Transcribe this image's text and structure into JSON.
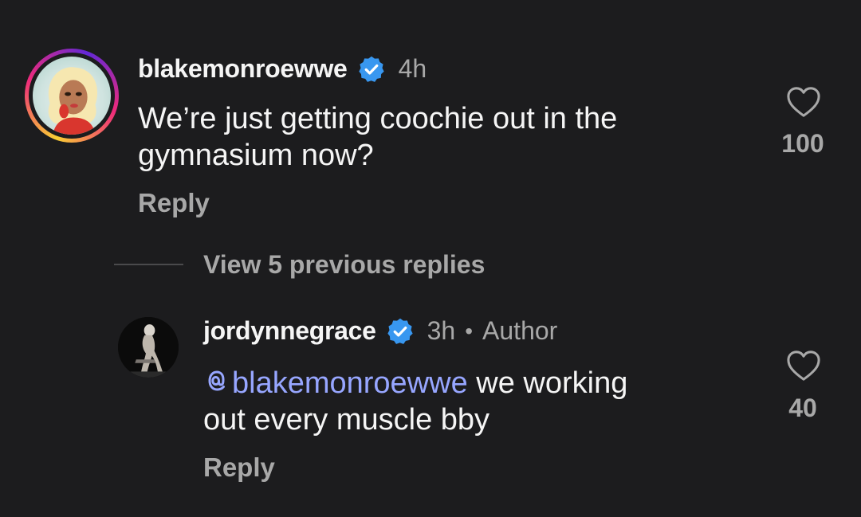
{
  "comments": [
    {
      "username": "blakemonroewwe",
      "verified": true,
      "time": "4h",
      "text": "We’re just getting coochie out in the gymnasium now?",
      "reply_label": "Reply",
      "likes": "100",
      "avatar_icon": "cartoon-avatar-icon"
    }
  ],
  "view_replies_label": "View 5 previous replies",
  "replies": [
    {
      "username": "jordynnegrace",
      "verified": true,
      "time": "3h",
      "separator": "•",
      "role": "Author",
      "mention": "blakemonroewwe",
      "text_line1": " we working",
      "text_line2": "out every muscle bby",
      "reply_label": "Reply",
      "likes": "40",
      "avatar_icon": "photo-avatar-icon"
    }
  ],
  "colors": {
    "background": "#1c1c1e",
    "primary_text": "#f5f5f5",
    "secondary_text": "#a8a8a8",
    "mention": "#97a6ff",
    "verified_badge": "#3897f0"
  }
}
